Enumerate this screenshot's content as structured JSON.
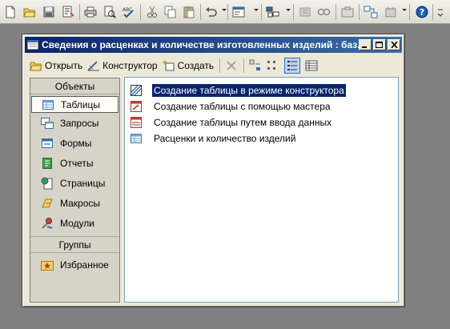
{
  "toolbar": {
    "icons": [
      "new-icon",
      "open-icon",
      "save-icon",
      "properties-icon",
      "print-icon",
      "preview-icon",
      "spelling-icon",
      "cut-icon",
      "copy-icon",
      "paste-icon",
      "undo-icon",
      "code-icon",
      "analyze-icon",
      "office-links-icon",
      "relationships-icon",
      "properties-icon",
      "new-object-icon",
      "help-icon"
    ]
  },
  "window": {
    "title": "Сведения о расценках и количестве изготовленных изделий : баз...",
    "toolbar": {
      "open_label": "Открыть",
      "design_label": "Конструктор",
      "create_label": "Создать"
    }
  },
  "sidebar": {
    "objects_header": "Объекты",
    "items": [
      {
        "label": "Таблицы",
        "icon": "table-icon"
      },
      {
        "label": "Запросы",
        "icon": "query-icon"
      },
      {
        "label": "Формы",
        "icon": "form-icon"
      },
      {
        "label": "Отчеты",
        "icon": "report-icon"
      },
      {
        "label": "Страницы",
        "icon": "page-icon"
      },
      {
        "label": "Макросы",
        "icon": "macro-icon"
      },
      {
        "label": "Модули",
        "icon": "module-icon"
      }
    ],
    "groups_header": "Группы",
    "groups": [
      {
        "label": "Избранное",
        "icon": "favorites-icon"
      }
    ]
  },
  "list": {
    "items": [
      {
        "label": "Создание таблицы в режиме конструктора",
        "icon": "design-mode-icon"
      },
      {
        "label": "Создание таблицы с помощью мастера",
        "icon": "wizard-icon"
      },
      {
        "label": "Создание таблицы путем ввода данных",
        "icon": "data-entry-icon"
      },
      {
        "label": "Расценки и количество изделий",
        "icon": "table-icon"
      }
    ]
  },
  "colors": {
    "titlebar": "#0a246a",
    "selection": "#0a246a"
  }
}
